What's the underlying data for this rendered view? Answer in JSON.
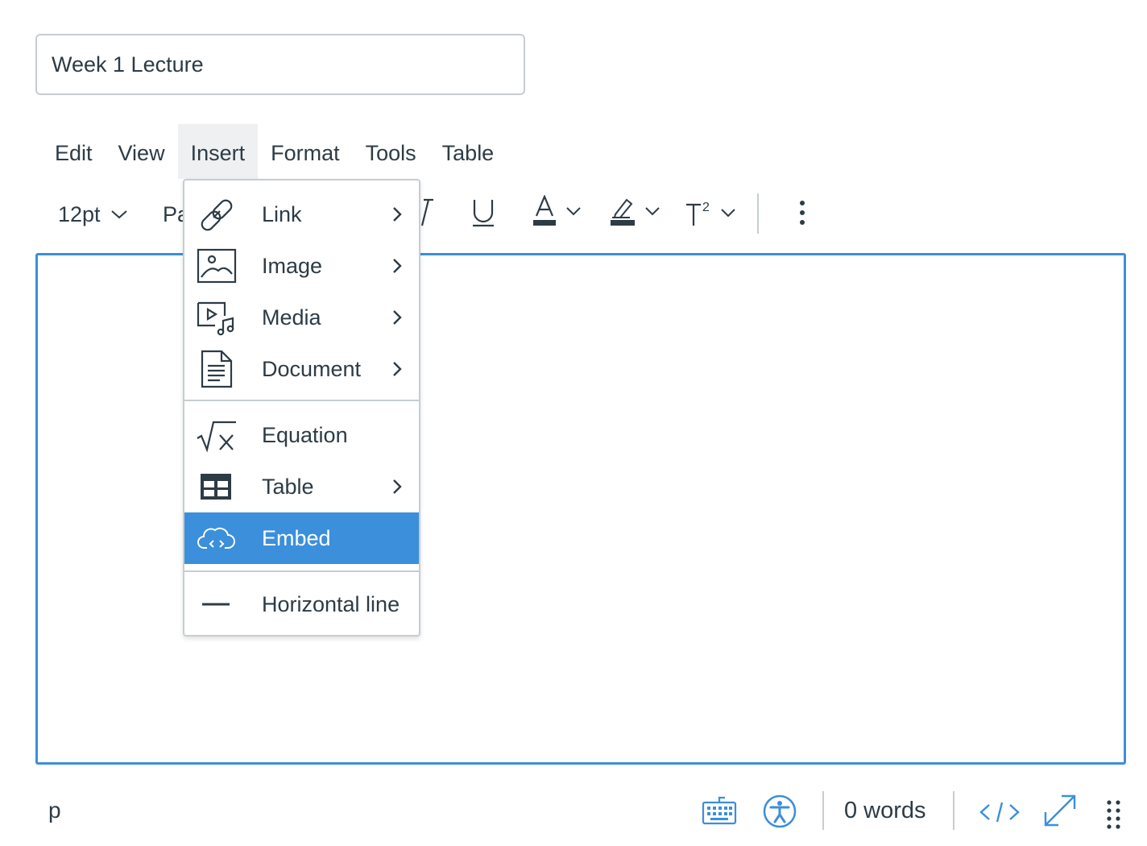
{
  "title_field": {
    "value": "Week 1 Lecture"
  },
  "menubar": {
    "items": [
      "Edit",
      "View",
      "Insert",
      "Format",
      "Tools",
      "Table"
    ],
    "active": "Insert"
  },
  "toolbar": {
    "font_size": "12pt",
    "block_format_partial": "Pa"
  },
  "insert_menu": {
    "items": [
      {
        "label": "Link",
        "icon": "link-icon",
        "submenu": true
      },
      {
        "label": "Image",
        "icon": "image-icon",
        "submenu": true
      },
      {
        "label": "Media",
        "icon": "media-icon",
        "submenu": true
      },
      {
        "label": "Document",
        "icon": "document-icon",
        "submenu": true
      },
      {
        "label": "Equation",
        "icon": "equation-icon",
        "submenu": false
      },
      {
        "label": "Table",
        "icon": "table-icon",
        "submenu": true
      },
      {
        "label": "Embed",
        "icon": "embed-icon",
        "submenu": false,
        "highlighted": true
      },
      {
        "label": "Horizontal line",
        "icon": "horizontal-line-icon",
        "submenu": false
      }
    ]
  },
  "statusbar": {
    "element_path": "p",
    "word_count": "0 words"
  },
  "colors": {
    "accent": "#3b8fdb",
    "text": "#2d3b45",
    "border": "#c7cdd1",
    "menu_active_bg": "#eef0f2"
  }
}
